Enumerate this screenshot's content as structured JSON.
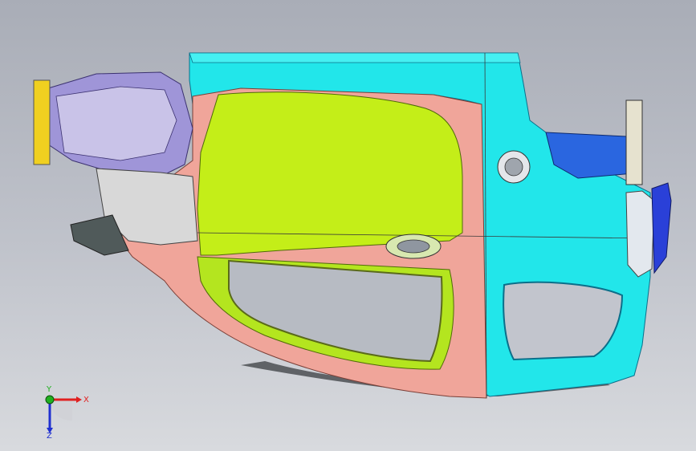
{
  "triad": {
    "x_label": "X",
    "y_label": "Y",
    "z_label": "Z"
  },
  "colors": {
    "background_top": "#a9adb7",
    "background_bottom": "#d8dade",
    "outer_panel_front": "#f0a59a",
    "outer_panel_rear": "#22e6ea",
    "inner_door_panel": "#c4ee18",
    "hinge_bracket": "#2a66e0",
    "front_structure": "#9f95d8",
    "axis_x": "#e02020",
    "axis_y": "#20b020",
    "axis_z": "#2030d0"
  },
  "icons": {
    "triad": "coordinate-triad-icon",
    "fuel_door": "fuel-filler-door-icon",
    "door_handle": "door-handle-icon"
  }
}
